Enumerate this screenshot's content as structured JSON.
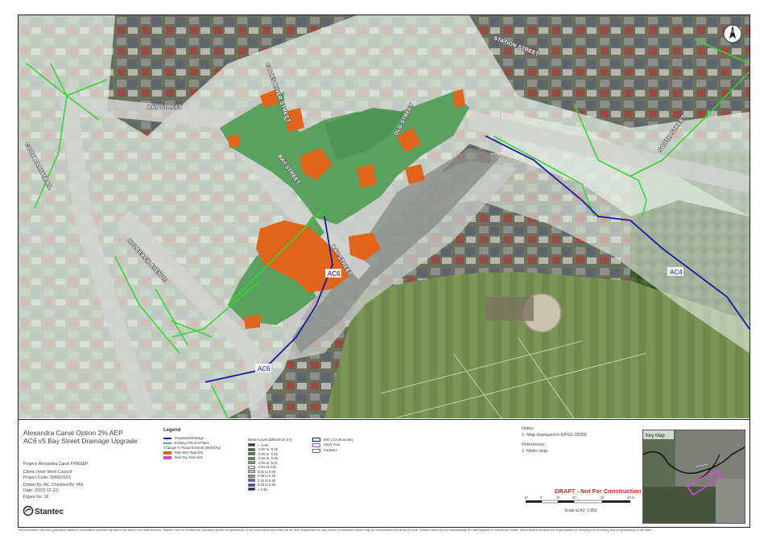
{
  "map": {
    "streets": [
      "BAY STREET",
      "BAY STREET",
      "BAY STREET",
      "COOKS RIVER STREET",
      "OLD STREET",
      "STATION STREET",
      "SOUTH STREET",
      "HOLBEACH AVENUE",
      "COOK PARK TRAIL",
      "IRONBARK STREET"
    ],
    "pipe_labels": [
      "AC6",
      "AC6",
      "AC4"
    ],
    "north_label": "N"
  },
  "title": {
    "line1": "Alexandra Canal Option 2% AEP",
    "line2": "AC6 v5 Bay Street Drainage Upgrade"
  },
  "meta": {
    "project": "Project: Alexandra Canal FRMS&P",
    "client": "Client:  Inner West Council",
    "code": "Project Code:  304603163",
    "drawn": "Drawn By:   AC, Checked By: MG",
    "date": "Date:   (2023-12-22)",
    "figure": "Figure No:   16"
  },
  "legend": {
    "title": "Legend",
    "proposed": "Proposed Drainage",
    "existing": "Existing Pits and Pipes",
    "change_title": "Change in Flood Extents (Wet/Dry)",
    "was_wet": "Was Wet, Now Dry",
    "was_dry": "Was Dry, Now Wet",
    "wl_title": "Water Level Difference (m)",
    "wl_rows": [
      "< -0.50",
      "-0.50 to -0.25",
      "-0.25 to -0.15",
      "-0.15 to -0.05",
      "-0.05 to -0.01",
      "-0.01 to 0.01",
      "0.01 to 0.05",
      "0.05 to 0.10",
      "0.10 to 0.25",
      "0.25 to 0.50",
      "> 0.50"
    ],
    "lga": "IWC LGA Boundary",
    "study": "Study Area",
    "cadastre": "Cadastre",
    "colors": {
      "proposed": "#1a1aa8",
      "existing": "#33d633",
      "was_wet": "#e0651a",
      "was_dry": "#d64bd6",
      "wl": [
        "#3b3b24",
        "#45663f",
        "#3f7d45",
        "#4d8f52",
        "#6ea373",
        "#e8ecea",
        "#b4bad6",
        "#8791c7",
        "#5a66b8",
        "#39469e",
        "#1e2875"
      ]
    }
  },
  "notes": {
    "heading": "Notes:",
    "n1": "1. Map displayed in EPSG:28356",
    "refs_heading": "References:",
    "r1": "1. Metro map"
  },
  "draft": "DRAFT - Not For Construction",
  "scale": {
    "ticks": [
      "10",
      "0",
      "10",
      "20",
      "30",
      "40 m"
    ],
    "text": "Scale at A3: 1:850"
  },
  "keymap": {
    "label": "Key Map"
  },
  "brand": "Stantec",
  "disclaimer": "This document has been prepared based on information provided by others as cited in the data sources. Stantec has not verified the accuracy and/or completeness of this information and shall not be held responsible for any errors or omissions which may be incorporated herein as a result. Stantec assumes no responsibility for data supplied in electronic format, and recipient accepts full responsibility for verifying the accuracy and completeness of the data."
}
